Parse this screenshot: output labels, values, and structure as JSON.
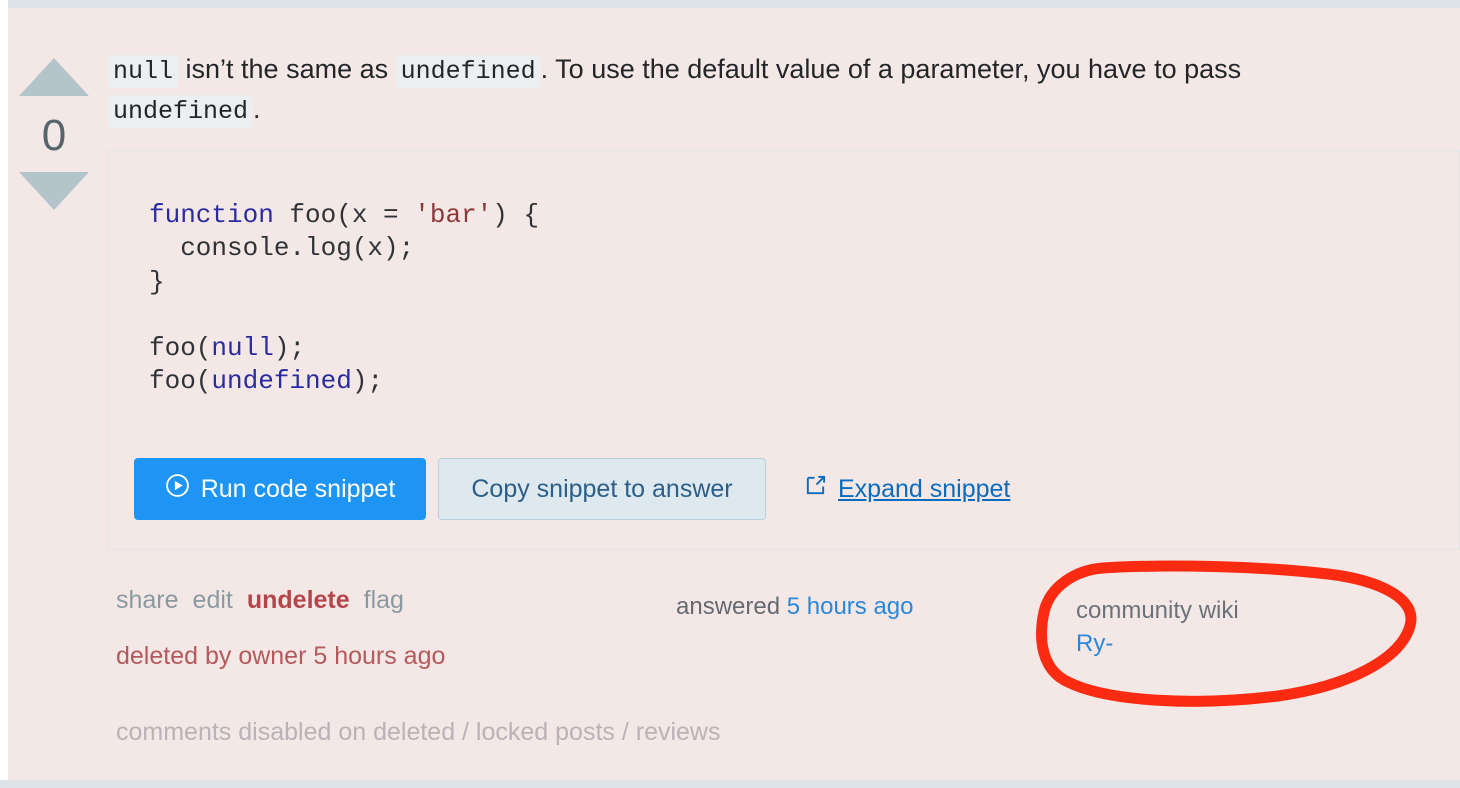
{
  "theme": {
    "post_background": "#f4e8e7",
    "accent_blue": "#1e94f5",
    "link_blue": "#2b87d8",
    "deleted_red": "#b4595c",
    "annotation_red": "#fb2b12",
    "vote_arrow": "#b4c4cb",
    "snippet_border": "#dfe5e8"
  },
  "votes": {
    "count": "0",
    "up_icon": "triangle-up-icon",
    "down_icon": "triangle-down-icon"
  },
  "body": {
    "code_1": "null",
    "text_1": " isn’t the same as ",
    "code_2": "undefined",
    "text_2": ". To use the default value of a parameter, you have to pass ",
    "code_3": "undefined",
    "text_3": "."
  },
  "snippet": {
    "code_lines": [
      "function foo(x = 'bar') {",
      "  console.log(x);",
      "}",
      "",
      "foo(null);",
      "foo(undefined);"
    ],
    "code_plain": "function foo(x = 'bar') {\n  console.log(x);\n}\n\nfoo(null);\nfoo(undefined);",
    "run_button": "Run code snippet",
    "run_icon": "play-circle-icon",
    "copy_button": "Copy snippet to answer",
    "expand_link": "Expand snippet",
    "expand_icon": "external-link-icon"
  },
  "footer": {
    "share": "share",
    "edit": "edit",
    "undelete": "undelete",
    "flag": "flag",
    "deleted_note": "deleted by owner 5 hours ago",
    "comments_disabled": "comments disabled on deleted / locked posts / reviews"
  },
  "answered": {
    "prefix": "answered",
    "time": "5 hours ago"
  },
  "user_card": {
    "wiki_label": "community wiki",
    "username": "Ry-"
  },
  "annotation": {
    "name": "red-circle-highlight",
    "shape": "hand-drawn-oval",
    "color": "#fb2b12",
    "target": "user-card"
  }
}
